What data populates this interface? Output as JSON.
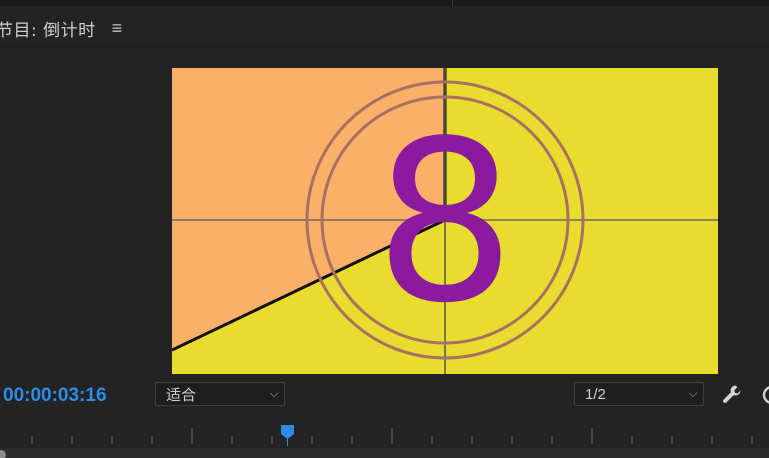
{
  "panel": {
    "title": "节目: 倒计时",
    "menu_icon": "hamburger-menu-icon"
  },
  "viewer": {
    "countdown_number": "8",
    "colors": {
      "wedge": "#fbb06a",
      "background": "#e8dd2f",
      "number": "#8b1a9e",
      "rings": "#a87062",
      "crosshair": "#333333"
    }
  },
  "controls": {
    "timecode": "00:00:03:16",
    "fit_value": "适合",
    "resolution_value": "1/2",
    "settings_icon": "wrench-icon",
    "timecode_color": "#2d8ceb"
  }
}
